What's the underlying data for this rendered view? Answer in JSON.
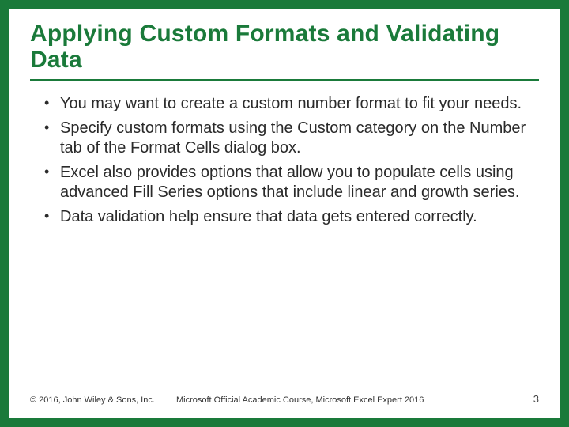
{
  "title": "Applying Custom Formats and Validating Data",
  "bullets": [
    "You may want to create a custom number format to fit your needs.",
    "Specify custom formats using the Custom category on the Number tab of the Format Cells dialog box.",
    "Excel also provides options that allow you to populate cells using advanced Fill Series options that include linear and growth series.",
    "Data validation help ensure that data gets entered correctly."
  ],
  "footer": {
    "copyright": "© 2016, John Wiley & Sons, Inc.",
    "course": "Microsoft Official Academic Course, Microsoft Excel Expert 2016",
    "page": "3"
  }
}
